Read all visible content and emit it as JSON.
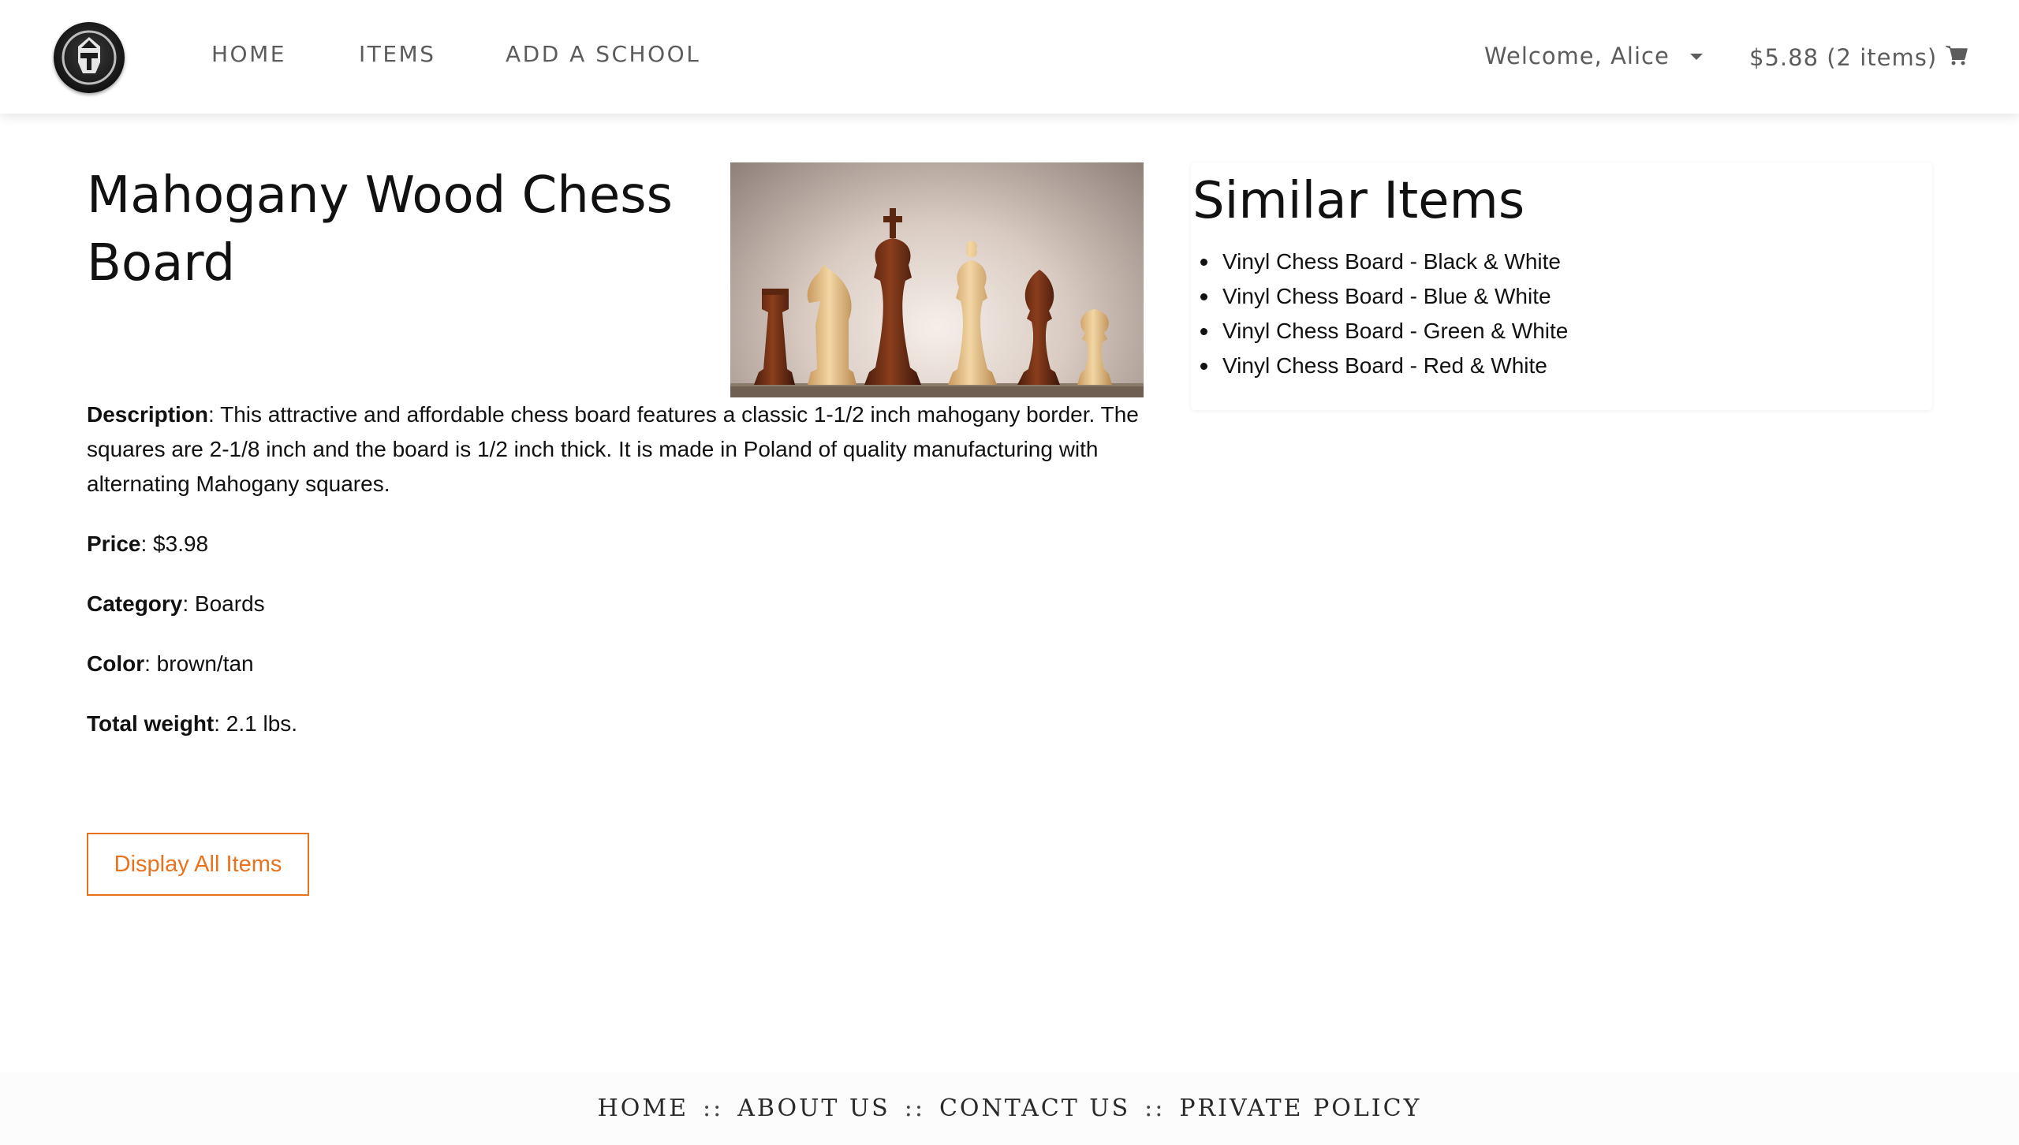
{
  "header": {
    "nav": [
      {
        "label": "HOME"
      },
      {
        "label": "ITEMS"
      },
      {
        "label": "ADD A SCHOOL"
      }
    ],
    "welcome": "Welcome, Alice",
    "cart": "$5.88 (2 items)"
  },
  "product": {
    "title": "Mahogany Wood Chess Board",
    "description_label": "Description",
    "description": ": This attractive and affordable chess board features a classic 1-1/2 inch mahogany border. The squares are 2-1/8 inch and the board is 1/2 inch thick. It is made in Poland of quality manufacturing with alternating Mahogany squares.",
    "price_label": "Price",
    "price": ": $3.98",
    "category_label": "Category",
    "category": ": Boards",
    "color_label": "Color",
    "color": ": brown/tan",
    "weight_label": "Total weight",
    "weight": ": 2.1 lbs.",
    "display_all_button": "Display All Items"
  },
  "similar": {
    "title": "Similar Items",
    "items": [
      "Vinyl Chess Board - Black & White",
      "Vinyl Chess Board - Blue & White",
      "Vinyl Chess Board - Green & White",
      "Vinyl Chess Board - Red & White"
    ]
  },
  "footer": {
    "links": [
      "HOME",
      "ABOUT US",
      "CONTACT US",
      "PRIVATE POLICY"
    ],
    "separator": "::"
  },
  "colors": {
    "accent": "#e8731f",
    "nav_text": "#5c5c5c"
  },
  "icons": {
    "logo": "helmet-logo-icon",
    "cart": "cart-icon",
    "caret": "caret-down-icon"
  }
}
